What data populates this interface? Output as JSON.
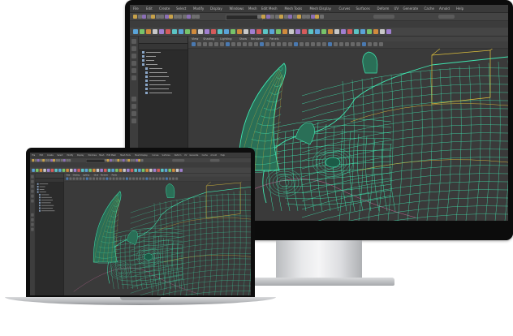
{
  "maya_ui": {
    "menus": [
      "File",
      "Edit",
      "Create",
      "Select",
      "Modify",
      "Display",
      "Windows",
      "Mesh",
      "Edit Mesh",
      "Mesh Tools",
      "Mesh Display",
      "Curves",
      "Surfaces",
      "Deform",
      "UV",
      "Generate",
      "Cache",
      "Arnold",
      "Help"
    ],
    "viewport_menus": [
      "View",
      "Shading",
      "Lighting",
      "Show",
      "Renderer",
      "Panels"
    ]
  },
  "colors": {
    "wire_main": "#3fe6b0",
    "wire_dark": "#1d8a66",
    "wire_accent": "#d6b43a",
    "horn_fill": "#2a6f57",
    "viewport_bg": "#3a3a3a",
    "selection_box": "#e0c23c"
  },
  "devices": [
    "monitor",
    "laptop"
  ]
}
